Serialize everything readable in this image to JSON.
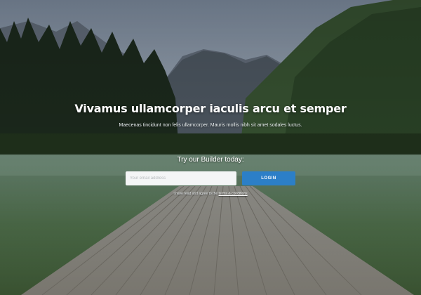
{
  "hero": {
    "title": "Vivamus ullamcorper iaculis arcu et semper",
    "subtitle": "Maecenas tincidunt non felis ullamcorper. Mauris mollis nibh sit amet sodales luctus.",
    "cta_text": "Try our Builder today:"
  },
  "form": {
    "email_placeholder": "Your email address",
    "email_value": "",
    "login_label": "LOGIN"
  },
  "terms": {
    "prefix": "I have read and agree to the ",
    "link_text": "terms & conditions"
  },
  "colors": {
    "button": "#2c7fc7",
    "input_bg": "#f4f5f6",
    "text": "#ffffff"
  },
  "background": {
    "description_icon": "mountain-lake-dock-photo"
  }
}
